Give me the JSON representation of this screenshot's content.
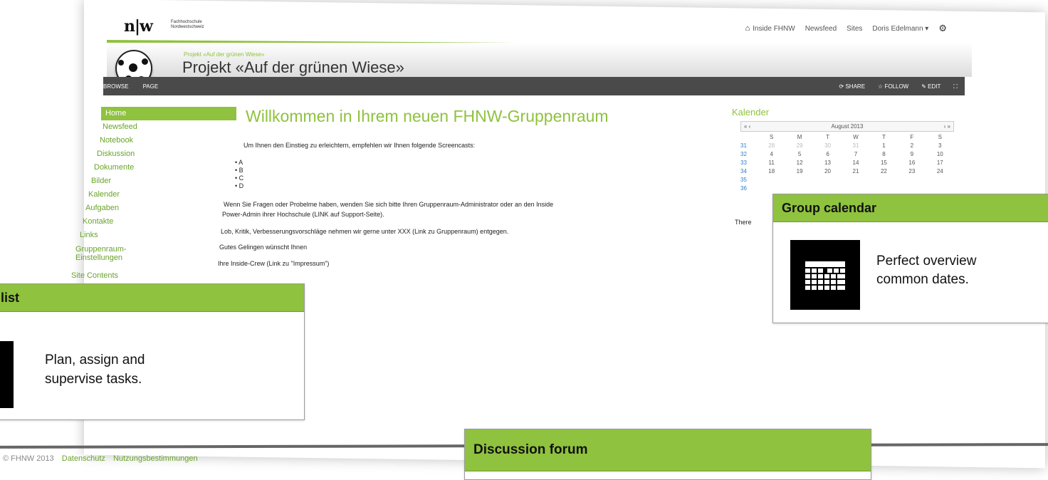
{
  "brand": {
    "logo": "n|w",
    "line1": "Fachhochschule",
    "line2": "Nordwestschweiz"
  },
  "topnav": {
    "inside": "Inside FHNW",
    "newsfeed": "Newsfeed",
    "sites": "Sites",
    "user": "Doris Edelmann ▾",
    "gear_icon": "gear-icon"
  },
  "site": {
    "crumb": "Projekt «Auf der grünen Wiese»",
    "title": "Projekt «Auf der grünen Wiese»"
  },
  "ribbon": {
    "browse": "BROWSE",
    "page": "PAGE",
    "share": "SHARE",
    "follow": "FOLLOW",
    "edit": "EDIT"
  },
  "leftnav": [
    "Home",
    "Newsfeed",
    "Notebook",
    "Diskussion",
    "Dokumente",
    "Bilder",
    "Kalender",
    "Aufgaben",
    "Kontakte",
    "Links",
    "Gruppenraum-\nEinstellungen",
    "Site Contents"
  ],
  "main": {
    "heading": "Willkommen in Ihrem neuen FHNW-Gruppenraum",
    "intro": "Um Ihnen den Einstieg zu erleichtern, empfehlen wir Ihnen folgende Screencasts:",
    "bullets": [
      "A",
      "B",
      "C",
      "D"
    ],
    "para1": "Wenn Sie Fragen oder Probelme haben, wenden Sie sich bitte Ihren Gruppenraum-Administrator oder an den Inside",
    "para1b": "Power-Admin ihrer Hochschule (LINK auf Support-Seite).",
    "para2": "Lob, Kritik, Verbesserungsvorschläge nehmen wir gerne unter XXX (Link zu Gruppenraum) entgegen.",
    "para3": "Gutes Gelingen wünscht Ihnen",
    "para4": "Ihre Inside-Crew (Link zu \"Impressum\")"
  },
  "calendar": {
    "title": "Kalender",
    "month": "August 2013",
    "nav_prev": "«  ‹",
    "nav_next": "›  »",
    "days": [
      "S",
      "M",
      "T",
      "W",
      "T",
      "F",
      "S"
    ],
    "weeks": [
      {
        "wk": "31",
        "d": [
          "28",
          "29",
          "30",
          "31",
          "1",
          "2",
          "3"
        ]
      },
      {
        "wk": "32",
        "d": [
          "4",
          "5",
          "6",
          "7",
          "8",
          "9",
          "10"
        ]
      },
      {
        "wk": "33",
        "d": [
          "11",
          "12",
          "13",
          "14",
          "15",
          "16",
          "17"
        ]
      },
      {
        "wk": "34",
        "d": [
          "18",
          "19",
          "20",
          "21",
          "22",
          "23",
          "24"
        ]
      },
      {
        "wk": "35",
        "d": [
          "",
          "",
          "",
          "",
          "",
          "",
          ""
        ]
      },
      {
        "wk": "36",
        "d": [
          "",
          "",
          "",
          "",
          "",
          "",
          ""
        ]
      }
    ],
    "partial_text": "There"
  },
  "callouts": {
    "group_calendar": {
      "title": "Group calendar",
      "text1": "Perfect overview",
      "text2": "common dates."
    },
    "task_list": {
      "title": "list",
      "text1": "Plan, assign and",
      "text2": "supervise tasks."
    },
    "discussion": {
      "title": "Discussion forum"
    }
  },
  "footer": {
    "copyright": "© FHNW 2013",
    "link1": "Datenschutz",
    "link2": "Nutzungsbestimmungen"
  }
}
